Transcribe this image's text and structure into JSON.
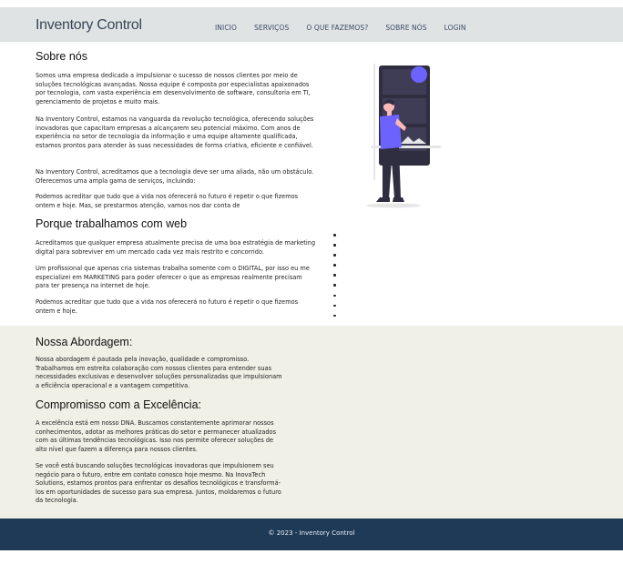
{
  "header": {
    "logo": "Inventory Control",
    "nav": [
      "INICIO",
      "SERVIÇOS",
      "O QUE FAZEMOS?",
      "SOBRE NÓS",
      "LOGIN"
    ]
  },
  "about": {
    "title": "Sobre nós",
    "paragraphs": [
      "Somos uma empresa dedicada a impulsionar o sucesso de nossos clientes por meio de soluções tecnológicas avançadas. Nossa equipe é composta por especialistas apaixonados por tecnologia, com vasta experiência em desenvolvimento de software, consultoria em TI, gerenciamento de projetos e muito mais.",
      "Na Inventory Control, estamos na vanguarda da revolução tecnológica, oferecendo soluções inovadoras que capacitam empresas a alcançarem seu potencial máximo. Com anos de experiência no setor de tecnologia da informação e uma equipe altamente qualificada, estamos prontos para atender às suas necessidades de forma criativa, eficiente e confiável.",
      "Na Inventory Control, acreditamos que a tecnologia deve ser uma aliada, não um obstáculo. Oferecemos uma ampla gama de serviços, incluindo:",
      "Podemos acreditar que tudo que a vida nos oferecerá no futuro é repetir o que fizemos ontem e hoje. Mas, se prestarmos atenção, vamos nos dar conta de"
    ]
  },
  "why": {
    "title": "Porque trabalhamos com web",
    "paragraphs": [
      "Acreditamos que qualquer empresa atualmente precisa de uma boa estratégia de marketing digital para sobreviver em um mercado cada vez mais restrito e concorrido.",
      "Um profissional que apenas cria sistemas trabalha somente com o DIGITAL, por isso eu me especializei em MARKETING para poder oferecer o que as empresas realmente precisam para ter presença na internet de hoje.",
      "Podemos acreditar que tudo que a vida nos oferecerá no futuro é repetir o que fizemos ontem e hoje."
    ]
  },
  "approach": {
    "title": "Nossa Abordagem:",
    "paragraph": "Nossa abordagem é pautada pela inovação, qualidade e compromisso. Trabalhamos em estreita colaboração com nossos clientes para entender suas necessidades exclusivas e desenvolver soluções personalizadas que impulsionam a eficiência operacional e a vantagem competitiva."
  },
  "commitment": {
    "title": "Compromisso com a Excelência:",
    "paragraphs": [
      "A excelência está em nosso DNA. Buscamos constantemente aprimorar nossos conhecimentos, adotar as melhores práticas do setor e permanecer atualizados com as últimas tendências tecnológicas. Isso nos permite oferecer soluções de alto nível que fazem a diferença para nossos clientes.",
      "Se você está buscando soluções tecnológicas inovadoras que impulsionem seu negócio para o futuro, entre em contato conosco hoje mesmo. Na InovaTech Solutions, estamos prontos para enfrentar os desafios tecnológicos e transformá-los em oportunidades de sucesso para sua empresa. Juntos, moldaremos o futuro da tecnologia."
    ]
  },
  "footer": {
    "text": "© 2023 - Inventory Control"
  },
  "colors": {
    "header_bg": "#dfe3e4",
    "nav_text": "#3d4b67",
    "approach_bg": "#f0f0e6",
    "footer_bg": "#1f3a56",
    "accent_purple": "#6c63ff",
    "illustration_dark": "#2f2e41"
  }
}
